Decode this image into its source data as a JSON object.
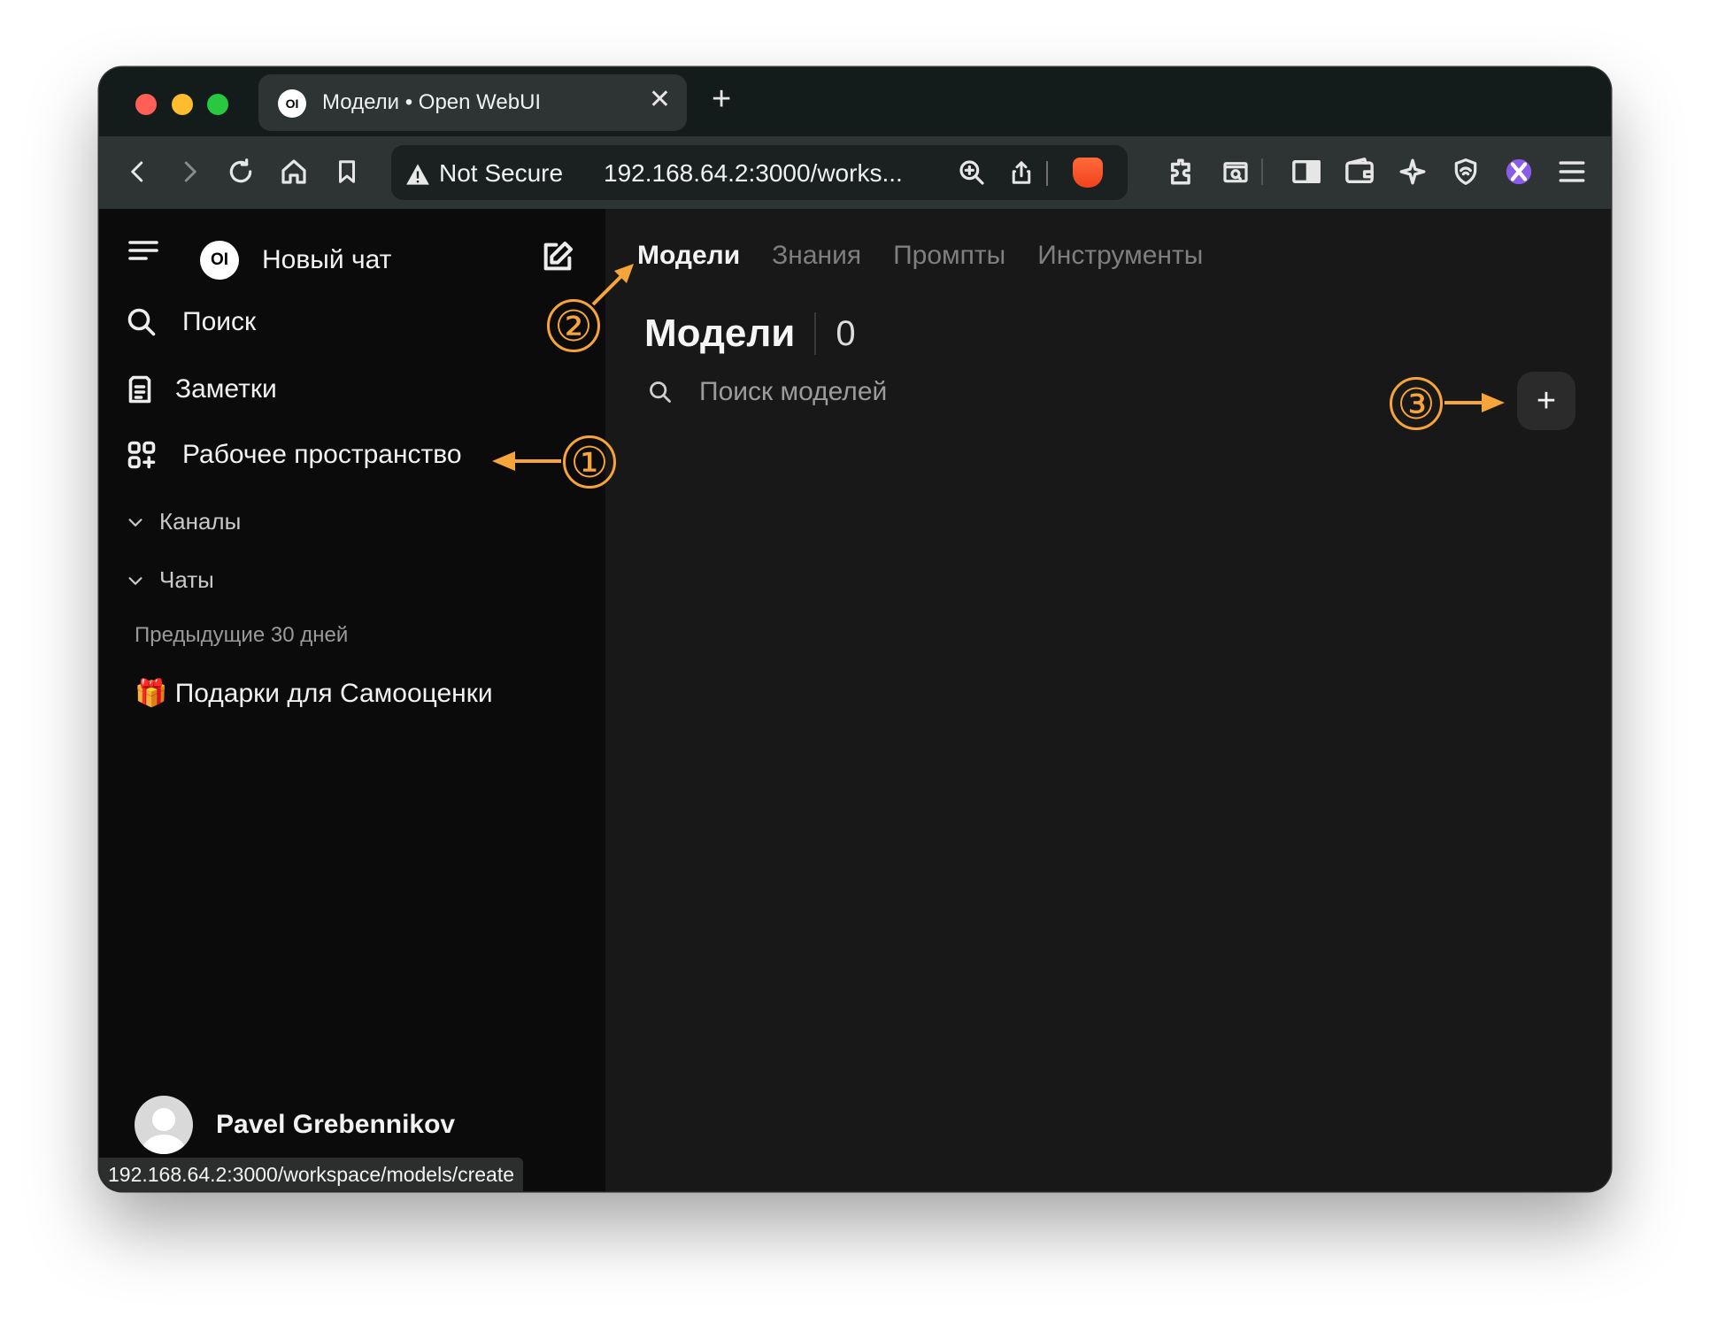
{
  "browser": {
    "tab_title": "Модели • Open WebUI",
    "tab_favicon_text": "OI",
    "not_secure": "Not Secure",
    "url": "192.168.64.2:3000/works...",
    "status_url": "192.168.64.2:3000/workspace/models/create"
  },
  "sidebar": {
    "logo_text": "OI",
    "new_chat": "Новый чат",
    "search": "Поиск",
    "notes": "Заметки",
    "workspace": "Рабочее пространство",
    "channels": "Каналы",
    "chats": "Чаты",
    "period": "Предыдущие 30 дней",
    "chat_item": "🎁 Подарки для Самооценки",
    "user_name": "Pavel Grebennikov"
  },
  "main": {
    "tabs": [
      "Модели",
      "Знания",
      "Промпты",
      "Инструменты"
    ],
    "heading": "Модели",
    "count": "0",
    "search_placeholder": "Поиск моделей",
    "add_label": "+"
  },
  "annotations": {
    "marker_1": "①",
    "marker_2": "②",
    "marker_3": "③",
    "color": "#f7a53a"
  }
}
